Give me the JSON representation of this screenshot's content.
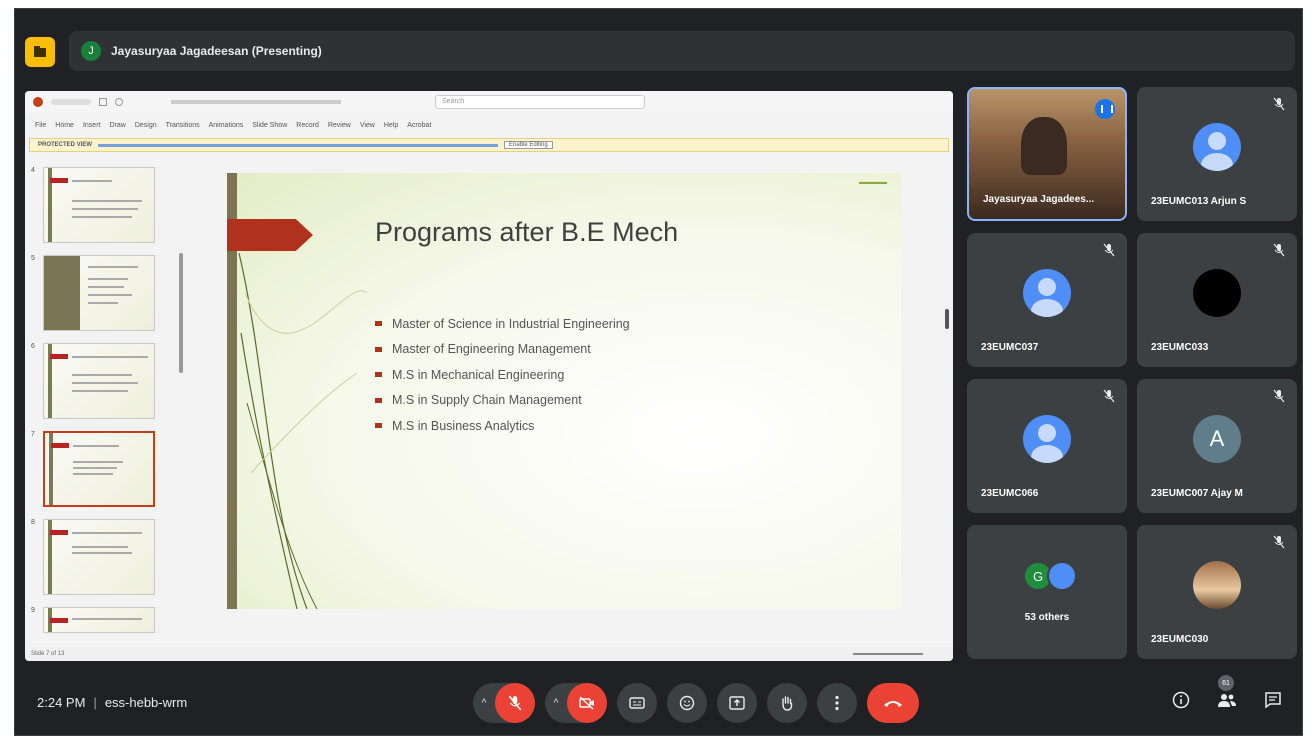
{
  "presenter": {
    "initial": "J",
    "label": "Jayasuryaa Jagadeesan (Presenting)"
  },
  "ppt": {
    "search_placeholder": "Search",
    "menu": [
      "File",
      "Home",
      "Insert",
      "Draw",
      "Design",
      "Transitions",
      "Animations",
      "Slide Show",
      "Record",
      "Review",
      "View",
      "Help",
      "Acrobat"
    ],
    "protected_label": "PROTECTED VIEW",
    "enable_editing": "Enable Editing",
    "status_left": "Slide 7 of 13",
    "thumb_numbers": [
      "4",
      "5",
      "6",
      "7",
      "8",
      "9"
    ]
  },
  "slide": {
    "title": "Programs after B.E Mech",
    "bullets": [
      "Master of Science in Industrial Engineering",
      "Master of Engineering Management",
      "M.S in Mechanical Engineering",
      "M.S in Supply Chain Management",
      "M.S in Business Analytics"
    ]
  },
  "participants": [
    {
      "name": "Jayasuryaa Jagadees...",
      "type": "video",
      "speaking": true
    },
    {
      "name": "23EUMC013 Arjun S",
      "type": "person",
      "muted": true
    },
    {
      "name": "23EUMC037",
      "type": "person",
      "muted": true
    },
    {
      "name": "23EUMC033",
      "type": "black",
      "muted": true
    },
    {
      "name": "23EUMC066",
      "type": "person",
      "muted": true
    },
    {
      "name": "23EUMC007 Ajay M",
      "type": "letter",
      "letter": "A",
      "muted": true
    },
    {
      "name": "53 others",
      "type": "group",
      "letter": "G"
    },
    {
      "name": "23EUMC030",
      "type": "photo",
      "muted": true
    }
  ],
  "footer": {
    "time": "2:24 PM",
    "meeting_code": "ess-hebb-wrm",
    "people_count": "61"
  },
  "colors": {
    "background": "#202124",
    "tile": "#3c4043",
    "accent_red": "#ea4335",
    "accent_blue": "#4f8ef7",
    "slide_accent": "#b1321c"
  }
}
